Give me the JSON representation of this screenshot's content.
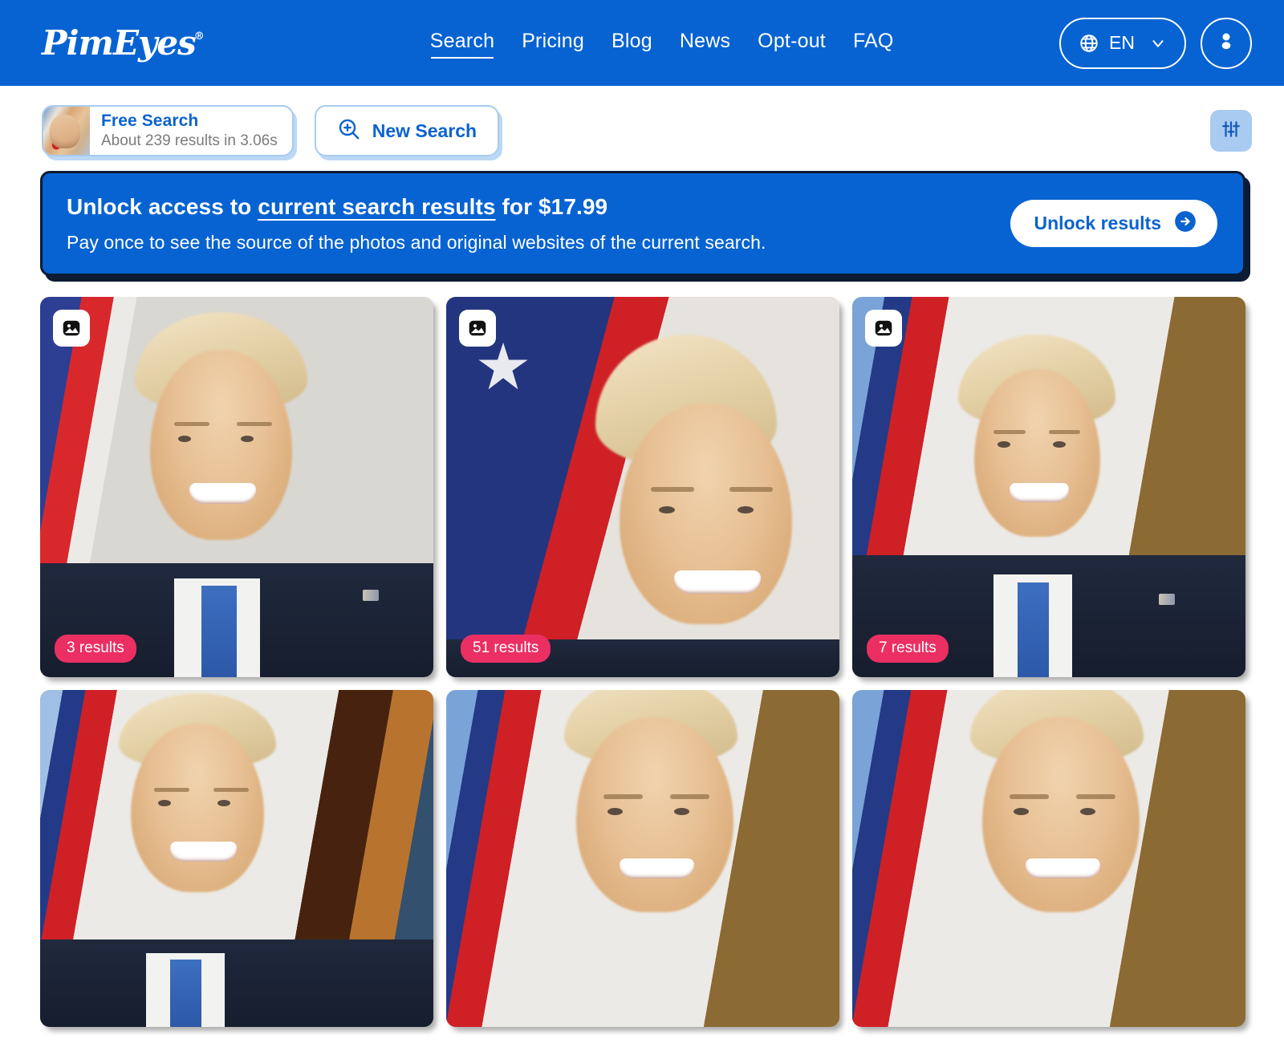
{
  "header": {
    "logo": "PimEyes",
    "logo_reg": "®",
    "nav": [
      {
        "label": "Search",
        "active": true
      },
      {
        "label": "Pricing",
        "active": false
      },
      {
        "label": "Blog",
        "active": false
      },
      {
        "label": "News",
        "active": false
      },
      {
        "label": "Opt-out",
        "active": false
      },
      {
        "label": "FAQ",
        "active": false
      }
    ],
    "language": "EN",
    "globe_icon": "globe-icon",
    "chevron_icon": "chevron-down-icon",
    "account_icon": "user-account-icon",
    "background_color": "#0763d2"
  },
  "searchbar": {
    "free_search_title": "Free Search",
    "free_search_subtitle": "About 239 results in 3.06s",
    "thumbnail_name": "query-face-thumbnail",
    "new_search_label": "New Search",
    "new_search_icon": "zoom-in-search-icon",
    "filter_icon": "sliders-filter-icon"
  },
  "banner": {
    "headline_pre": "Unlock access to ",
    "headline_link": "current search results",
    "headline_post": " for $17.99",
    "price": "$17.99",
    "description": "Pay once to see the source of the photos and original websites of the current search.",
    "cta_label": "Unlock results",
    "cta_icon": "arrow-right-circle-icon",
    "background_color": "#0763d2",
    "border_color": "#0d1b33"
  },
  "results": {
    "image_icon": "photo-image-icon",
    "badge_color": "#eb2f63",
    "cards": [
      {
        "badge": "3 results",
        "has_badge": true,
        "has_icon": true
      },
      {
        "badge": "51 results",
        "has_badge": true,
        "has_icon": true
      },
      {
        "badge": "7 results",
        "has_badge": true,
        "has_icon": true
      },
      {
        "badge": "",
        "has_badge": false,
        "has_icon": false
      },
      {
        "badge": "",
        "has_badge": false,
        "has_icon": false
      },
      {
        "badge": "",
        "has_badge": false,
        "has_icon": false
      }
    ]
  }
}
